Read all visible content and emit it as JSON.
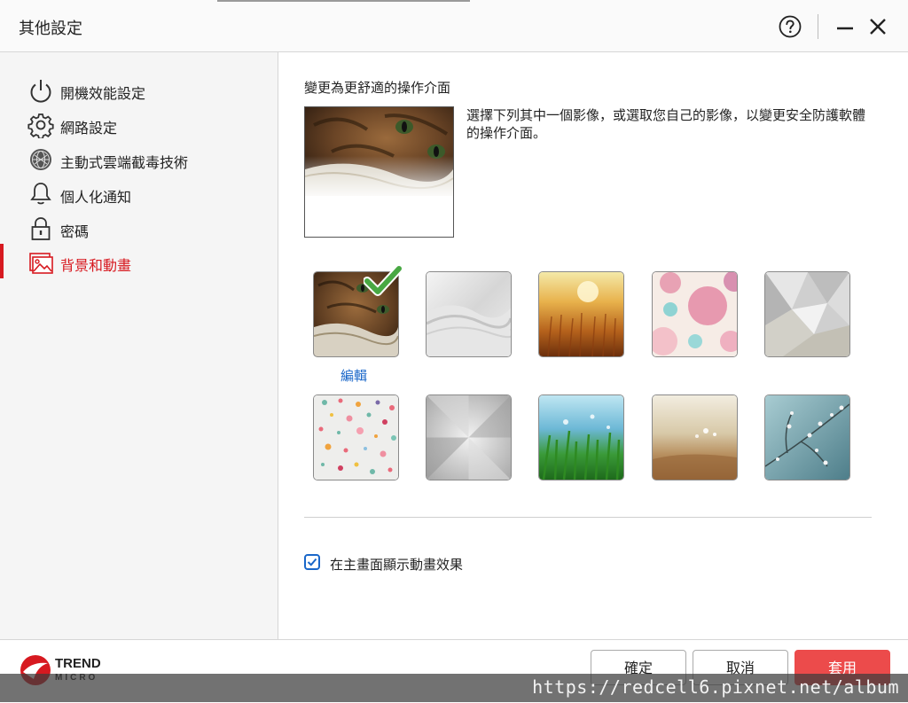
{
  "window": {
    "title": "其他設定",
    "icons": {
      "help": "help-circle-icon",
      "minimize": "minimize-icon",
      "close": "close-icon"
    }
  },
  "sidebar": {
    "items": [
      {
        "label": "開機效能設定",
        "icon": "power-icon",
        "active": false
      },
      {
        "label": "網路設定",
        "icon": "gear-icon",
        "active": false
      },
      {
        "label": "主動式雲端截毒技術",
        "icon": "globe-icon",
        "active": false
      },
      {
        "label": "個人化通知",
        "icon": "bell-icon",
        "active": false
      },
      {
        "label": "密碼",
        "icon": "lock-icon",
        "active": false
      },
      {
        "label": "背景和動畫",
        "icon": "picture-icon",
        "active": true
      }
    ],
    "accent_color": "#d71920"
  },
  "main": {
    "section_title": "變更為更舒適的操作介面",
    "description": "選擇下列其中一個影像，或選取您自己的影像，以變更安全防護軟體的操作介面。",
    "edit_label": "編輯",
    "thumbnails": [
      {
        "name": "cat",
        "selected": true
      },
      {
        "name": "silver-waves",
        "selected": false
      },
      {
        "name": "golden-field",
        "selected": false
      },
      {
        "name": "pastel-circles",
        "selected": false
      },
      {
        "name": "geometric-gray",
        "selected": false
      },
      {
        "name": "confetti-dots",
        "selected": false
      },
      {
        "name": "brushed-metal",
        "selected": false
      },
      {
        "name": "green-grass",
        "selected": false
      },
      {
        "name": "sandy-beach",
        "selected": false
      },
      {
        "name": "blossom-branch",
        "selected": false
      }
    ],
    "animation_checkbox": {
      "label": "在主畫面顯示動畫效果",
      "checked": true
    }
  },
  "footer": {
    "logo_text": "TREND MICRO",
    "buttons": {
      "ok": "確定",
      "cancel": "取消",
      "apply": "套用"
    },
    "apply_color": "#ec4b4b"
  },
  "watermark": "https://redcell6.pixnet.net/album"
}
